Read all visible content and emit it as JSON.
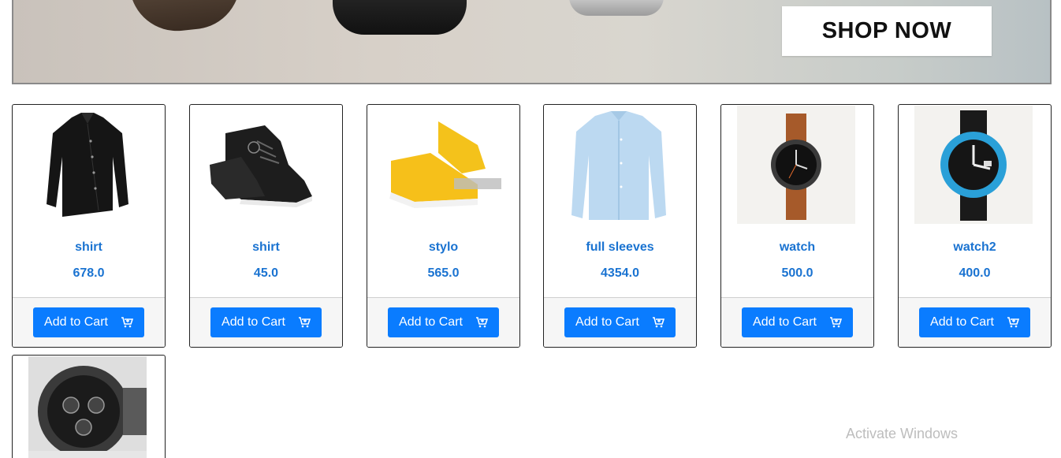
{
  "banner": {
    "cta_label": "SHOP NOW"
  },
  "products": [
    {
      "name": "shirt",
      "price": "678.0",
      "button": "Add to Cart",
      "image": "black-shirt"
    },
    {
      "name": "shirt",
      "price": "45.0",
      "button": "Add to Cart",
      "image": "black-sneaker"
    },
    {
      "name": "stylo",
      "price": "565.0",
      "button": "Add to Cart",
      "image": "yellow-shoe"
    },
    {
      "name": "full sleeves",
      "price": "4354.0",
      "button": "Add to Cart",
      "image": "blue-shirt"
    },
    {
      "name": "watch",
      "price": "500.0",
      "button": "Add to Cart",
      "image": "brown-watch"
    },
    {
      "name": "watch2",
      "price": "400.0",
      "button": "Add to Cart",
      "image": "blue-watch"
    }
  ],
  "partial_product": {
    "image": "silver-watch"
  },
  "os_overlay": {
    "text": "Activate Windows"
  },
  "colors": {
    "accent": "#0a7cff",
    "link": "#1a73d1"
  }
}
